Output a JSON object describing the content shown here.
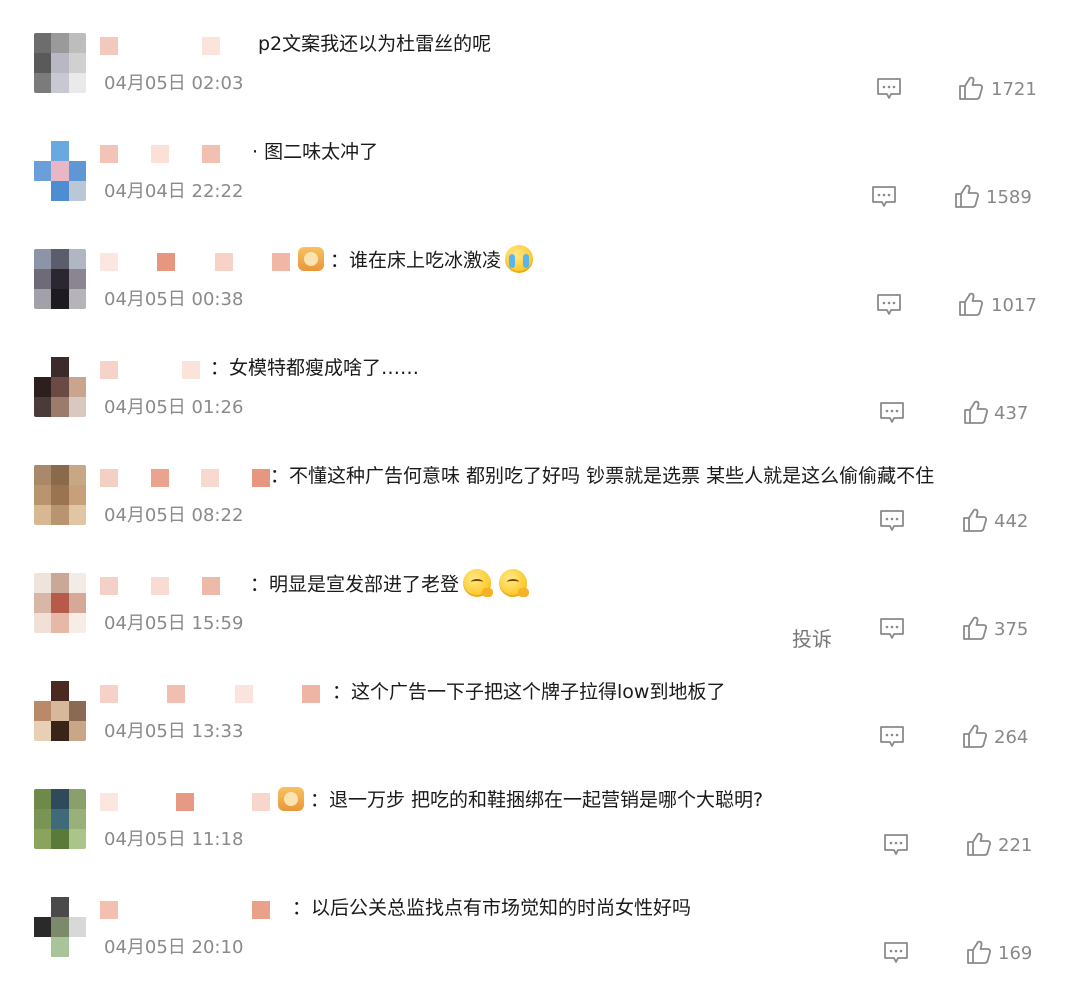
{
  "comments": [
    {
      "text": "p2文案我还以为杜雷丝的呢",
      "date": "04月05日 02:03",
      "likes": "1721",
      "avatar": [
        "#6d6d6d",
        "#9a9a9a",
        "#bdbdbd",
        "#5a5a5a",
        "#b8b8c4",
        "#d0d0d0",
        "#7b7b7b",
        "#c8c8d2",
        "#eaeaea"
      ],
      "nick": [
        {
          "c": "#f3c9bd"
        },
        {
          "c": "#fbe4dc"
        }
      ]
    },
    {
      "text": "· 图二味太冲了",
      "date": "04月04日 22:22",
      "likes": "1589",
      "avatar": [
        "#ffffff",
        "#6aa9e0",
        "#ffffff",
        "#6b9fd9",
        "#e8b6c4",
        "#5f97d6",
        "#ffffff",
        "#4d8dd2",
        "#b9c7d6"
      ],
      "nick": [
        {
          "c": "#f2c3b6"
        },
        {
          "c": "#fbe0d7"
        },
        {
          "c": "#f1c0b2"
        }
      ]
    },
    {
      "text": "谁在床上吃冰激凌",
      "date": "04月05日 00:38",
      "likes": "1017",
      "avatar": [
        "#8d94a8",
        "#5b5d6d",
        "#b1b6c3",
        "#6f6a78",
        "#2b2730",
        "#8a8590",
        "#a2a0a8",
        "#1d1a22",
        "#b6b3bb"
      ],
      "nick": [
        {
          "c": "#fbe6e0"
        },
        {
          "c": "#e7977f"
        },
        {
          "c": "#f6d2c8"
        },
        {
          "c": "#f0b6a6"
        }
      ],
      "badge": true,
      "emoji": "cry"
    },
    {
      "text": "女模特都瘦成啥了……",
      "date": "04月05日 01:26",
      "likes": "437",
      "avatar": [
        "#ffffff",
        "#3b2b2b",
        "#ffffff",
        "#2e1f1f",
        "#6b4a44",
        "#c9a48f",
        "#4a3a3a",
        "#9b7b6b",
        "#d8c8bf"
      ],
      "nick": [
        {
          "c": "#f6d3c9"
        },
        {
          "c": "#fbe3dc"
        }
      ]
    },
    {
      "text": "不懂这种广告何意味 都别吃了好吗 钞票就是选票 某些人就是这么偷偷藏不住",
      "date": "04月05日 08:22",
      "likes": "442",
      "avatar": [
        "#a88a6a",
        "#8a6a4a",
        "#c8a884",
        "#b9946e",
        "#9a7452",
        "#c7a07a",
        "#d8b892",
        "#b99470",
        "#e0c6a4"
      ],
      "nick": [
        {
          "c": "#f4cfc4"
        },
        {
          "c": "#e9a38e"
        },
        {
          "c": "#f7d9d0"
        },
        {
          "c": "#e79780"
        }
      ]
    },
    {
      "text": "明显是宣发部进了老登",
      "date": "04月05日 15:59",
      "likes": "375",
      "avatar": [
        "#efe4dc",
        "#c9a897",
        "#f3ebe5",
        "#d9b7a6",
        "#b65a4a",
        "#d6a898",
        "#f2dfd6",
        "#e5b8a8",
        "#f7ece6"
      ],
      "nick": [
        {
          "c": "#f4d0c6"
        },
        {
          "c": "#f8dcd4"
        },
        {
          "c": "#efb9aa"
        }
      ],
      "emoji": "think2",
      "report": "投诉"
    },
    {
      "text": "这个广告一下子把这个牌子拉得low到地板了",
      "date": "04月05日 13:33",
      "likes": "264",
      "avatar": [
        "#ffffff",
        "#4a2a20",
        "#ffffff",
        "#b88a6a",
        "#d8b89a",
        "#8a6a52",
        "#e8d0b4",
        "#3a2418",
        "#c8a688"
      ],
      "nick": [
        {
          "c": "#f5d1c7"
        },
        {
          "c": "#f1bfb1"
        },
        {
          "c": "#fbe4dd"
        },
        {
          "c": "#eeb4a4"
        }
      ]
    },
    {
      "text": "退一万步 把吃的和鞋捆绑在一起营销是哪个大聪明?",
      "date": "04月05日 11:18",
      "likes": "221",
      "avatar": [
        "#6e8a4a",
        "#2f4a5a",
        "#8aa06a",
        "#7a9456",
        "#3e6a7a",
        "#9ab07a",
        "#8aa45e",
        "#5a7a3a",
        "#aac48a"
      ],
      "nick": [
        {
          "c": "#fbe6e0"
        },
        {
          "c": "#e69a84"
        },
        {
          "c": "#f7d6cc"
        }
      ],
      "badge": true
    },
    {
      "text": "以后公关总监找点有市场觉知的时尚女性好吗",
      "date": "04月05日 20:10",
      "likes": "169",
      "avatar": [
        "#ffffff",
        "#4a4a4a",
        "#ffffff",
        "#2a2a2a",
        "#7a8a6a",
        "#d8d8d8",
        "#ffffff",
        "#a8c49a",
        "#ffffff"
      ],
      "nick": [
        {
          "c": "#f3bfae"
        },
        {
          "c": "#eba08a"
        }
      ]
    }
  ]
}
